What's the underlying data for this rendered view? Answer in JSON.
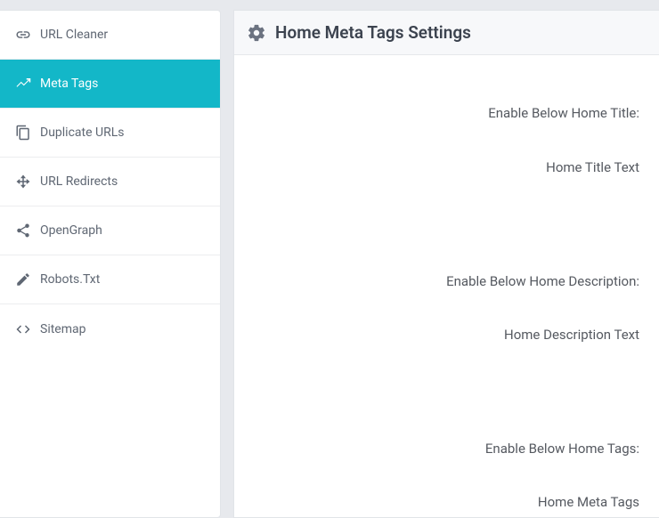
{
  "sidebar": {
    "items": [
      {
        "label": "URL Cleaner",
        "icon": "link-icon",
        "active": false
      },
      {
        "label": "Meta Tags",
        "icon": "chart-line-icon",
        "active": true
      },
      {
        "label": "Duplicate URLs",
        "icon": "copy-icon",
        "active": false
      },
      {
        "label": "URL Redirects",
        "icon": "arrows-icon",
        "active": false
      },
      {
        "label": "OpenGraph",
        "icon": "share-icon",
        "active": false
      },
      {
        "label": "Robots.Txt",
        "icon": "pencil-icon",
        "active": false
      },
      {
        "label": "Sitemap",
        "icon": "code-icon",
        "active": false
      }
    ]
  },
  "main": {
    "title": "Home Meta Tags Settings",
    "form": {
      "enable_title_label": "Enable Below Home Title:",
      "title_text_label": "Home Title Text",
      "enable_description_label": "Enable Below Home Description:",
      "description_text_label": "Home Description Text",
      "enable_tags_label": "Enable Below Home Tags:",
      "meta_tags_label": "Home Meta Tags"
    }
  }
}
